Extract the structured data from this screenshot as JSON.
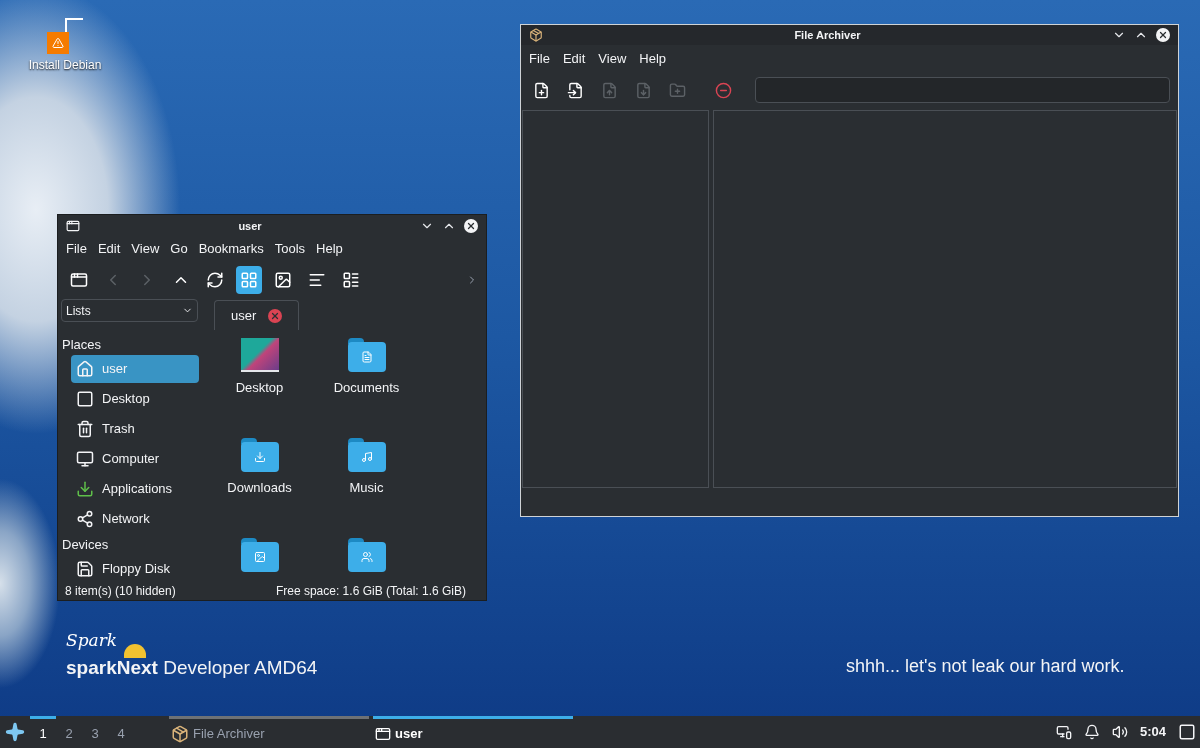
{
  "desktop": {
    "icons": [
      {
        "label": "Install Debian"
      }
    ]
  },
  "wallpaper": {
    "logo": "Spark",
    "brand": "**sparkNext** Developer AMD64",
    "tagline": "shhh... let's not leak our hard work."
  },
  "file_manager": {
    "title": "user",
    "menu": [
      "File",
      "Edit",
      "View",
      "Go",
      "Bookmarks",
      "Tools",
      "Help"
    ],
    "toolbar": [
      {
        "disabled": false,
        "selected": false
      },
      {
        "disabled": true,
        "selected": false
      },
      {
        "disabled": true,
        "selected": false
      },
      {
        "disabled": false,
        "selected": false
      },
      {
        "disabled": false,
        "selected": false
      },
      {
        "disabled": false,
        "selected": true
      },
      {
        "disabled": false,
        "selected": false
      },
      {
        "disabled": false,
        "selected": false
      },
      {
        "disabled": false,
        "selected": false
      }
    ],
    "side_pane_selector": {
      "value": "Lists"
    },
    "tabs": [
      {
        "label": "user",
        "selected": true
      }
    ],
    "sidebar": [
      {
        "heading": "Places",
        "items": [
          {
            "label": "user",
            "selected": true
          },
          {
            "label": "Desktop",
            "selected": false
          },
          {
            "label": "Trash",
            "selected": false
          },
          {
            "label": "Computer",
            "selected": false
          },
          {
            "label": "Applications",
            "selected": false
          },
          {
            "label": "Network",
            "selected": false
          }
        ]
      },
      {
        "heading": "Devices",
        "items": [
          {
            "label": "Floppy Disk",
            "selected": false
          }
        ]
      }
    ],
    "files": [
      {
        "kind": "desktop",
        "label": "Desktop"
      },
      {
        "kind": "folder",
        "label": "Documents"
      },
      {
        "kind": "folder",
        "label": "Downloads"
      },
      {
        "kind": "folder",
        "label": "Music"
      },
      {
        "kind": "folder"
      },
      {
        "kind": "folder"
      }
    ],
    "status_bar": {
      "items": "8 item(s) (10 hidden)",
      "free_space": "Free space: 1.6 GiB (Total: 1.6 GiB)"
    }
  },
  "archiver": {
    "title": "File Archiver",
    "menu": [
      "File",
      "Edit",
      "View",
      "Help"
    ],
    "toolbar": [
      {
        "disabled": false
      },
      {
        "disabled": false
      },
      {
        "disabled": true
      },
      {
        "disabled": true
      },
      {
        "disabled": true
      },
      {
        "disabled": false
      }
    ]
  },
  "taskbar": {
    "desktops": [
      {
        "label": "1",
        "selected": true
      },
      {
        "label": "2",
        "selected": false
      },
      {
        "label": "3",
        "selected": false
      },
      {
        "label": "4",
        "selected": false
      }
    ],
    "tasks": [
      {
        "label": "File Archiver",
        "selected": false
      },
      {
        "label": "user",
        "selected": true
      }
    ],
    "clock": "5:04"
  }
}
